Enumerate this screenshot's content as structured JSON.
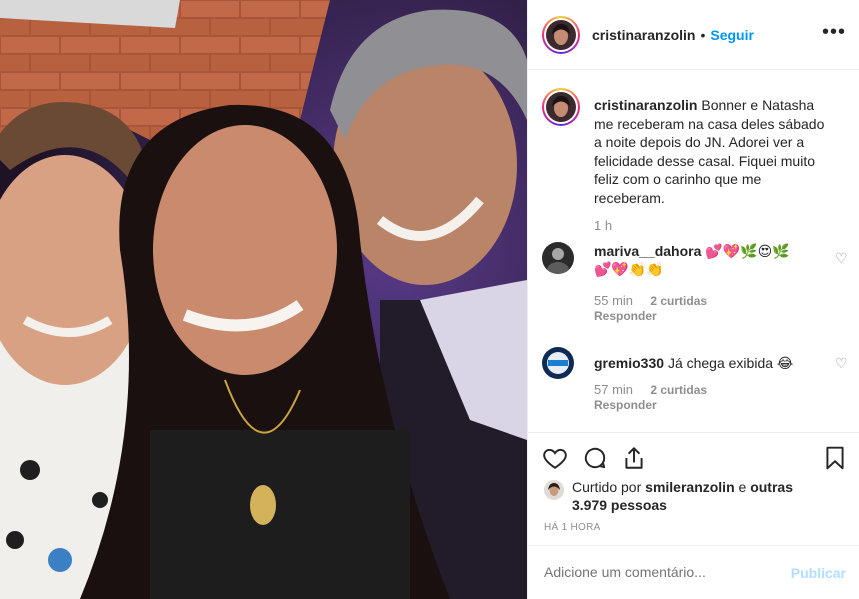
{
  "post": {
    "author": "cristinaranzolin",
    "separator": "•",
    "follow_label": "Seguir",
    "more_icon": "more-horizontal-icon",
    "photo_alt": "",
    "caption_text": "Bonner e Natasha me receberam na casa deles sábado a noite depois do JN. Adorei ver a felicidade desse casal. Fiquei muito feliz com o carinho que me receberam.",
    "caption_time": "1 h"
  },
  "comments": [
    {
      "username": "mariva__dahora",
      "text": "💕💖🌿😍🌿💕💖👏👏",
      "time": "55 min",
      "likes": "2 curtidas",
      "reply_label": "Responder"
    },
    {
      "username": "gremio330",
      "text": "Já chega exibida 😂",
      "time": "57 min",
      "likes": "2 curtidas",
      "reply_label": "Responder"
    }
  ],
  "actions": {
    "like_icon": "heart-icon",
    "comment_icon": "comment-icon",
    "share_icon": "share-icon",
    "save_icon": "bookmark-icon"
  },
  "likes": {
    "prefix": "Curtido por",
    "user": "smileranzolin",
    "conjunction": "e",
    "others": "outras 3.979 pessoas"
  },
  "timestamp": "HÁ 1 HORA",
  "add_comment": {
    "placeholder": "Adicione um comentário...",
    "publish_label": "Publicar"
  },
  "colors": {
    "link": "#0095f6",
    "muted": "#8e8e8e",
    "text": "#262626",
    "publish_disabled": "#b2dffc",
    "border": "#efefef"
  }
}
